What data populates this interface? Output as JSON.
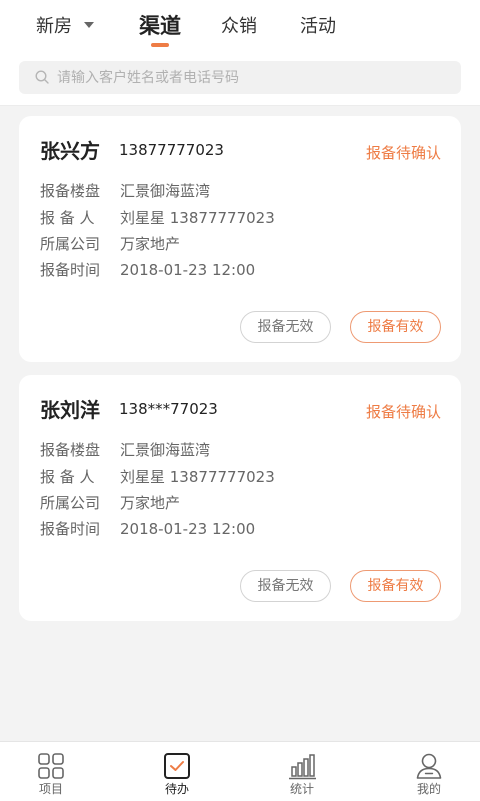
{
  "header": {
    "tabs": [
      {
        "label": "新房"
      },
      {
        "label": "渠道"
      },
      {
        "label": "众销"
      },
      {
        "label": "活动"
      }
    ],
    "active_tab": "渠道",
    "accent_color": "#ee7c45"
  },
  "search": {
    "placeholder": "请输入客户姓名或者电话号码",
    "value": ""
  },
  "cards": [
    {
      "name": "张兴方",
      "phone": "13877777023",
      "status": "报备待确认",
      "rows": [
        {
          "label": "报备楼盘",
          "value": "汇景御海蓝湾"
        },
        {
          "label": "报 备 人",
          "value": "刘星星  13877777023"
        },
        {
          "label": "所属公司",
          "value": "万家地产"
        },
        {
          "label": "报备时间",
          "value": "2018-01-23  12:00"
        }
      ],
      "invalid_label": "报备无效",
      "valid_label": "报备有效"
    },
    {
      "name": "张刘洋",
      "phone": "138***77023",
      "status": "报备待确认",
      "rows": [
        {
          "label": "报备楼盘",
          "value": "汇景御海蓝湾"
        },
        {
          "label": "报 备 人",
          "value": "刘星星  13877777023"
        },
        {
          "label": "所属公司",
          "value": "万家地产"
        },
        {
          "label": "报备时间",
          "value": "2018-01-23  12:00"
        }
      ],
      "invalid_label": "报备无效",
      "valid_label": "报备有效"
    }
  ],
  "tabbar": {
    "items": [
      {
        "label": "项目",
        "icon": "grid-icon"
      },
      {
        "label": "待办",
        "icon": "checkbox-icon"
      },
      {
        "label": "统计",
        "icon": "bar-chart-icon"
      },
      {
        "label": "我的",
        "icon": "user-icon"
      }
    ],
    "active": "待办"
  }
}
